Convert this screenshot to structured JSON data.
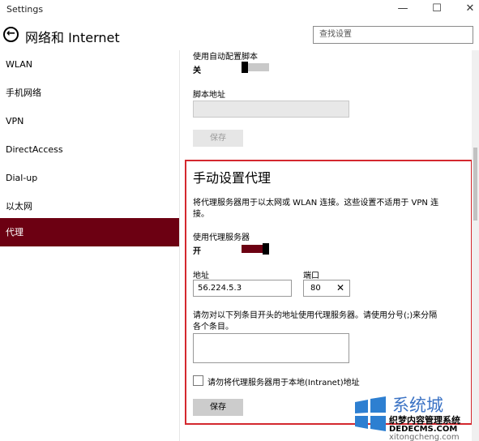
{
  "window": {
    "title": "Settings",
    "minimize": "—",
    "maximize": "☐",
    "close": "✕"
  },
  "header": {
    "back_glyph": "←",
    "title": "网络和 Internet",
    "search_placeholder": "查找设置"
  },
  "sidebar": {
    "items": [
      {
        "label": "WLAN"
      },
      {
        "label": "手机网络"
      },
      {
        "label": "VPN"
      },
      {
        "label": "DirectAccess"
      },
      {
        "label": "Dial-up"
      },
      {
        "label": "以太网"
      },
      {
        "label": "代理"
      }
    ],
    "active_index": 6,
    "active_color": "#6c0012"
  },
  "auto_proxy": {
    "script_label": "使用自动配置脚本",
    "script_state": "关",
    "address_label": "脚本地址",
    "address_value": "",
    "save_label": "保存"
  },
  "manual_proxy": {
    "heading": "手动设置代理",
    "description_line1": "将代理服务器用于以太网或 WLAN 连接。这些设置不适用于 VPN 连",
    "description_line2": "接。",
    "use_proxy_label": "使用代理服务器",
    "use_proxy_state": "开",
    "address_label": "地址",
    "address_value": "56.224.5.3",
    "port_label": "端口",
    "port_value": "80",
    "clear_glyph": "✕",
    "exceptions_line1": "请勿对以下列条目开头的地址使用代理服务器。请使用分号(;)来分隔",
    "exceptions_line2": "各个条目。",
    "exceptions_value": "",
    "local_checkbox_label": "请勿将代理服务器用于本地(Intranet)地址",
    "save_label": "保存",
    "highlight_color": "#d4282e"
  },
  "watermark": {
    "brand": "系统城",
    "line1": "织梦内容管理系统",
    "line2": "DEDECMS.COM",
    "line3": "xitongcheng.com"
  }
}
